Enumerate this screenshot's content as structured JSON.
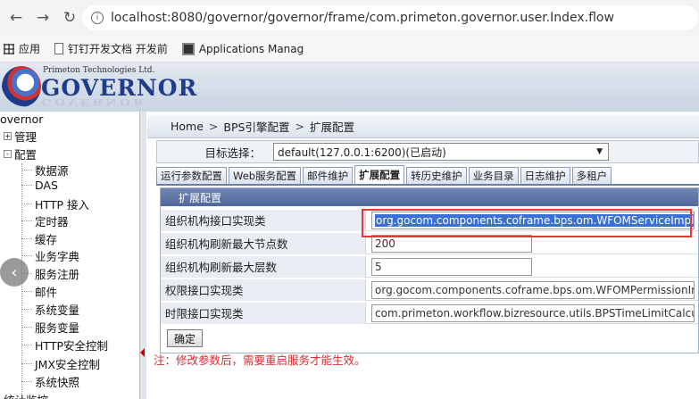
{
  "browser": {
    "url": "localhost:8080/governor/governor/frame/com.primeton.governor.user.Index.flow",
    "bookmarks": [
      {
        "label": "应用",
        "icon": "apps-grid-icon"
      },
      {
        "label": "钉钉开发文档 开发前",
        "icon": "document-icon"
      },
      {
        "label": "Applications Manag",
        "icon": "application-icon"
      }
    ]
  },
  "header": {
    "company": "Primeton Technologies Ltd.",
    "product": "GOVERNOR"
  },
  "tree": {
    "root": "overnor",
    "items": [
      {
        "label": "管理",
        "level": 1,
        "toggle": "+"
      },
      {
        "label": "配置",
        "level": 1,
        "toggle": "-"
      },
      {
        "label": "数据源",
        "level": 2
      },
      {
        "label": "DAS",
        "level": 2
      },
      {
        "label": "HTTP 接入",
        "level": 2
      },
      {
        "label": "定时器",
        "level": 2
      },
      {
        "label": "缓存",
        "level": 2
      },
      {
        "label": "业务字典",
        "level": 2
      },
      {
        "label": "服务注册",
        "level": 2
      },
      {
        "label": "邮件",
        "level": 2
      },
      {
        "label": "系统变量",
        "level": 2
      },
      {
        "label": "服务变量",
        "level": 2
      },
      {
        "label": "HTTP安全控制",
        "level": 2
      },
      {
        "label": "JMX安全控制",
        "level": 2
      },
      {
        "label": "系统快照",
        "level": 2
      }
    ],
    "bottom": "统计监控"
  },
  "main": {
    "breadcrumb": [
      "Home",
      "BPS引擎配置",
      "扩展配置"
    ],
    "target_label": "目标选择：",
    "target_value": "default(127.0.0.1:6200)(已启动)",
    "tabs": [
      {
        "label": "运行参数配置",
        "active": false
      },
      {
        "label": "Web服务配置",
        "active": false
      },
      {
        "label": "邮件维护",
        "active": false
      },
      {
        "label": "扩展配置",
        "active": true
      },
      {
        "label": "转历史维护",
        "active": false
      },
      {
        "label": "业务目录",
        "active": false
      },
      {
        "label": "日志维护",
        "active": false
      },
      {
        "label": "多租户",
        "active": false
      }
    ],
    "panel_title": "扩展配置",
    "rows": [
      {
        "label": "组织机构接口实现类",
        "value": "org.gocom.components.coframe.bps.om.WFOMServiceImpl",
        "selected": true
      },
      {
        "label": "组织机构刷新最大节点数",
        "value": "200",
        "selected": false
      },
      {
        "label": "组织机构刷新最大层数",
        "value": "5",
        "selected": false
      },
      {
        "label": "权限接口实现类",
        "value": "org.gocom.components.coframe.bps.om.WFOMPermissionImpl",
        "selected": false
      },
      {
        "label": "时限接口实现类",
        "value": "com.primeton.workflow.bizresource.utils.BPSTimeLimitCalculator",
        "selected": false
      }
    ],
    "confirm_label": "确定",
    "note": "注：修改参数后，需要重启服务才能生效。"
  },
  "colors": {
    "highlight": "#e53935",
    "note": "#d32f2f",
    "panel_header": "#50679a",
    "selection": "#3a6fd8"
  }
}
